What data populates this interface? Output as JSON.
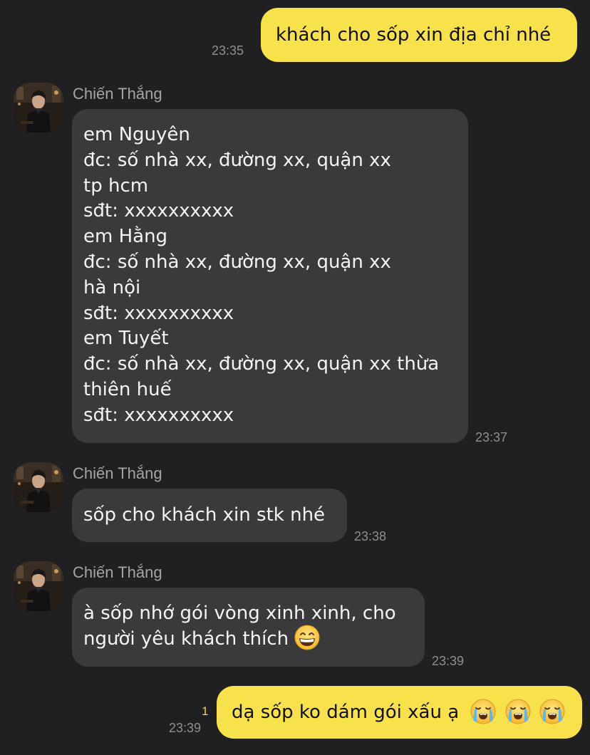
{
  "contact": {
    "name": "Chiến Thắng"
  },
  "colors": {
    "background": "#202022",
    "outgoing_bubble": "#f7e24b",
    "incoming_bubble": "#3a3a3d",
    "timestamp": "#8e8e93",
    "unread_count": "#f2d33f"
  },
  "messages": [
    {
      "direction": "out",
      "text": "khách cho sốp xin địa chỉ nhé",
      "time": "23:35"
    },
    {
      "direction": "in",
      "sender": "Chiến Thắng",
      "text": "em Nguyên\nđc: số nhà xx, đường xx, quận xx\ntp hcm\nsđt: xxxxxxxxxx\nem Hằng\nđc: số nhà xx, đường xx, quận xx\nhà nội\nsđt: xxxxxxxxxx\nem Tuyết\nđc: số nhà xx, đường xx, quận xx thừa\nthiên huế\nsđt: xxxxxxxxxx",
      "time": "23:37"
    },
    {
      "direction": "in",
      "sender": "Chiến Thắng",
      "text": "sốp cho khách xin stk nhé",
      "time": "23:38"
    },
    {
      "direction": "in",
      "sender": "Chiến Thắng",
      "text_line1": "à sốp nhớ gói vòng xinh xinh, cho",
      "text_line2": "người yêu khách thích",
      "emoji": "grinning-face-with-smiling-eyes",
      "time": "23:39"
    },
    {
      "direction": "out",
      "text": "dạ sốp ko dám gói xấu ạ",
      "emoji": [
        "loudly-crying-face",
        "loudly-crying-face",
        "loudly-crying-face"
      ],
      "unread_count": "1",
      "time": "23:39"
    }
  ]
}
